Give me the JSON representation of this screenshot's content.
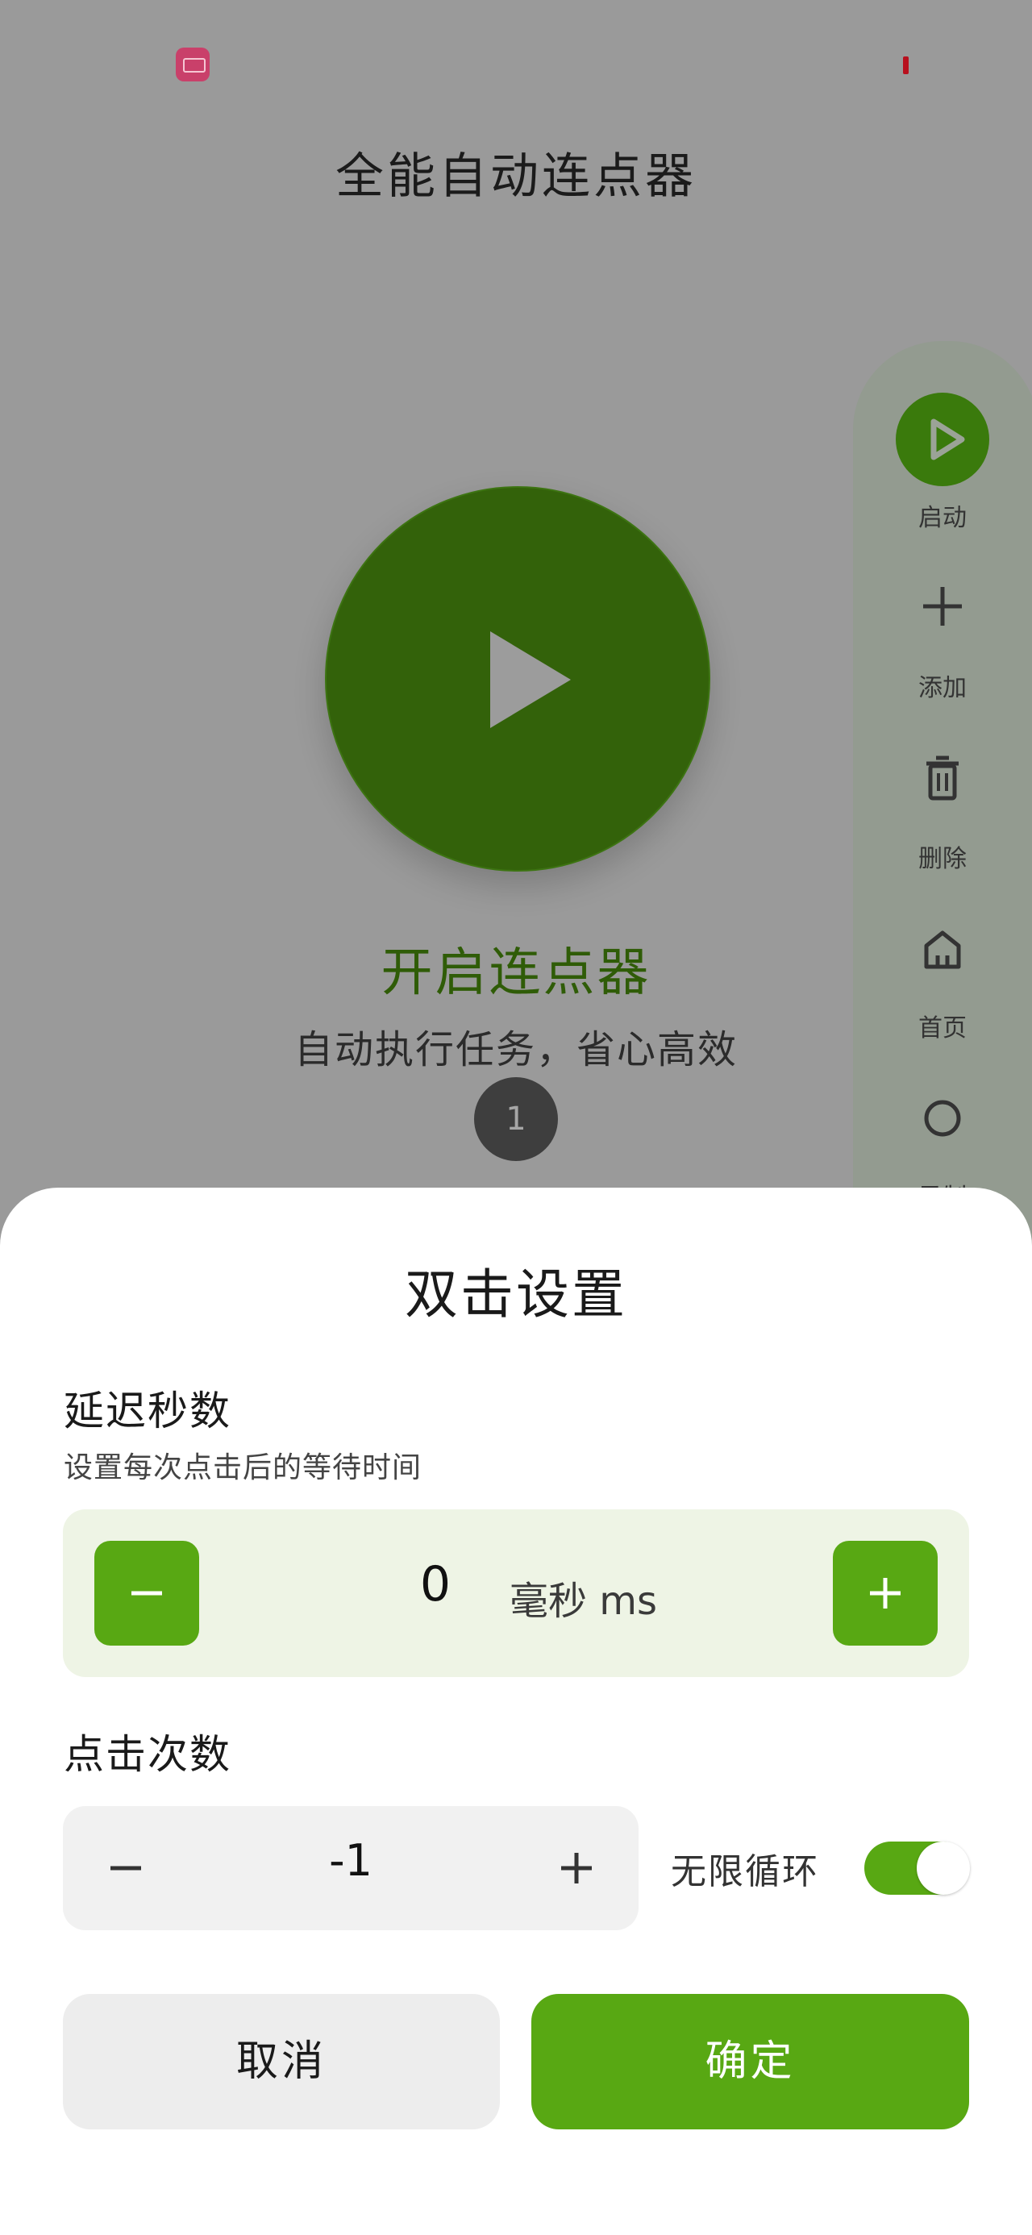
{
  "app": {
    "title": "全能自动连点器"
  },
  "hero": {
    "title": "开启连点器",
    "subtitle": "自动执行任务，省心高效",
    "step_badge": "1"
  },
  "side_rail": {
    "items": [
      {
        "label": "启动",
        "icon": "play-icon"
      },
      {
        "label": "添加",
        "icon": "plus-icon"
      },
      {
        "label": "删除",
        "icon": "trash-icon"
      },
      {
        "label": "首页",
        "icon": "home-icon"
      },
      {
        "label": "录制",
        "icon": "circle-icon"
      }
    ]
  },
  "dialog": {
    "title": "双击设置",
    "delay": {
      "title": "延迟秒数",
      "description": "设置每次点击后的等待时间",
      "value": "0",
      "unit": "毫秒 ms"
    },
    "count": {
      "title": "点击次数",
      "value": "-1",
      "loop_label": "无限循环",
      "loop_enabled": true
    },
    "cancel_label": "取消",
    "confirm_label": "确定"
  },
  "colors": {
    "overlay": "#9a9a9a",
    "primary_green": "#58a813",
    "dark_green": "#33620a",
    "delay_box": "#eef4e5"
  }
}
